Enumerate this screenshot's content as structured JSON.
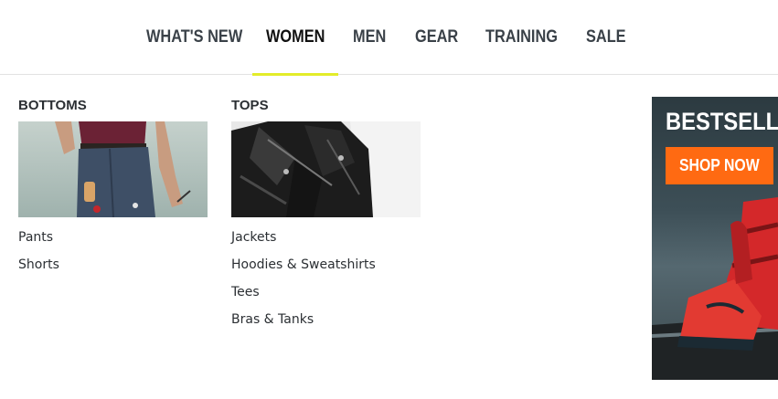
{
  "nav": {
    "items": [
      {
        "label": "WHAT'S NEW"
      },
      {
        "label": "WOMEN"
      },
      {
        "label": "MEN"
      },
      {
        "label": "GEAR"
      },
      {
        "label": "TRAINING"
      },
      {
        "label": "SALE"
      }
    ],
    "active_label": "WOMEN",
    "accent_color": "#e3ec2a"
  },
  "menu": {
    "columns": [
      {
        "heading": "BOTTOMS",
        "image": "woman-in-jeans-photo",
        "links": [
          "Pants",
          "Shorts"
        ]
      },
      {
        "heading": "TOPS",
        "image": "leather-jacket-photo",
        "links": [
          "Jackets",
          "Hoodies & Sweatshirts",
          "Tees",
          "Bras & Tanks"
        ]
      }
    ]
  },
  "promo": {
    "title": "BESTSELL",
    "button_label": "SHOP NOW",
    "button_color": "#ff6a12",
    "image": "red-sneakers-photo"
  }
}
